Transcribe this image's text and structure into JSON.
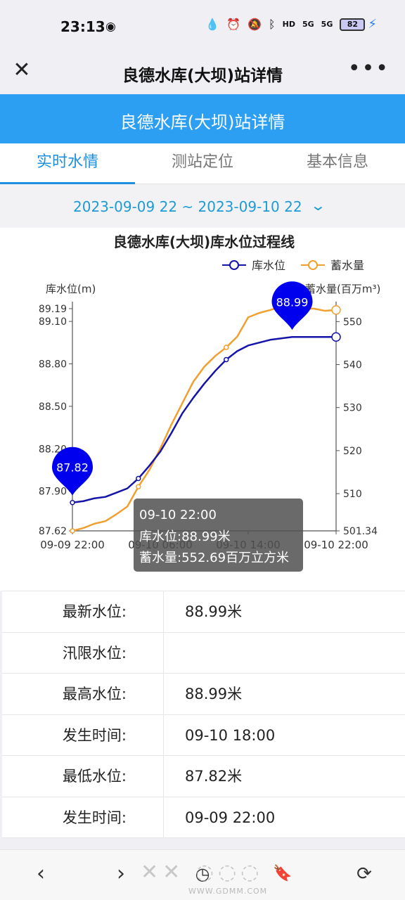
{
  "status_bar": {
    "time": "23:13",
    "weibo_icon": "weibo-icon",
    "network_labels": [
      "HD",
      "5G",
      "5G"
    ],
    "battery": "82"
  },
  "title_bar": {
    "title": "良德水库(大坝)站详情",
    "close_icon": "close-icon",
    "more_icon": "more-icon"
  },
  "banner": {
    "title": "良德水库(大坝)站详情"
  },
  "tabs": [
    {
      "label": "实时水情",
      "active": true
    },
    {
      "label": "测站定位",
      "active": false
    },
    {
      "label": "基本信息",
      "active": false
    }
  ],
  "date_range": {
    "text": "2023-09-09 22 ~ 2023-09-10 22"
  },
  "chart_data": {
    "type": "line",
    "title": "良德水库(大坝)库水位过程线",
    "y_left_label": "库水位(m)",
    "y_right_label": "蓄水量(百万m³)",
    "x_tick_labels": [
      "09-09 22:00",
      "09-10 06:00",
      "09-10 14:00",
      "09-10 22:00"
    ],
    "y_left_ticks": [
      "87.62",
      "87.90",
      "88.20",
      "88.50",
      "88.80",
      "89.10",
      "89.19"
    ],
    "y_right_ticks": [
      "501.34",
      "510",
      "520",
      "530",
      "540",
      "550"
    ],
    "y_left_range": [
      87.62,
      89.19
    ],
    "y_right_range": [
      501.34,
      553.0
    ],
    "legend_position": "top-right",
    "series": [
      {
        "name": "库水位",
        "axis": "left",
        "color": "#1414a8",
        "x_hours": [
          0,
          1,
          2,
          3,
          4,
          5,
          6,
          7,
          8,
          9,
          10,
          11,
          12,
          13,
          14,
          15,
          16,
          17,
          18,
          19,
          20,
          21,
          22,
          23,
          24
        ],
        "values": [
          87.82,
          87.83,
          87.85,
          87.86,
          87.89,
          87.92,
          87.99,
          88.08,
          88.18,
          88.31,
          88.45,
          88.56,
          88.66,
          88.75,
          88.83,
          88.89,
          88.93,
          88.95,
          88.97,
          88.98,
          88.99,
          88.99,
          88.99,
          88.99,
          88.99
        ]
      },
      {
        "name": "蓄水量",
        "axis": "right",
        "color": "#f0a030",
        "x_hours": [
          0,
          1,
          2,
          3,
          4,
          5,
          6,
          7,
          8,
          9,
          10,
          11,
          12,
          13,
          14,
          15,
          16,
          17,
          18,
          19,
          20,
          21,
          22,
          23,
          24
        ],
        "values": [
          501.34,
          502.0,
          503.0,
          503.6,
          505.2,
          507.0,
          511.6,
          515.5,
          520.5,
          526.0,
          531.0,
          536.0,
          539.5,
          542.0,
          544.0,
          546.5,
          551.0,
          552.0,
          552.69,
          553.5,
          549.5,
          553.0,
          553.0,
          552.5,
          552.69
        ]
      }
    ],
    "marker_pins": [
      {
        "label": "87.82",
        "x_hour": 0,
        "series": "库水位"
      },
      {
        "label": "88.99",
        "x_hour": 20,
        "series": "库水位"
      }
    ],
    "tooltip": {
      "time": "09-10 22:00",
      "line1": "库水位:88.99米",
      "line2": "蓄水量:552.69百万立方米"
    }
  },
  "info_table": [
    {
      "label": "最新水位:",
      "value": "88.99米"
    },
    {
      "label": "汛限水位:",
      "value": ""
    },
    {
      "label": "最高水位:",
      "value": "88.99米"
    },
    {
      "label": "发生时间:",
      "value": "09-10 18:00"
    },
    {
      "label": "最低水位:",
      "value": "87.82米"
    },
    {
      "label": "发生时间:",
      "value": "09-09 22:00"
    }
  ],
  "bottom_nav": {
    "back_icon": "back-icon",
    "forward_icon": "forward-icon",
    "history_icon": "history-icon",
    "bookmark_icon": "bookmark-icon",
    "refresh_icon": "refresh-icon"
  },
  "watermark": {
    "text": "WWW.GDMM.COM"
  }
}
